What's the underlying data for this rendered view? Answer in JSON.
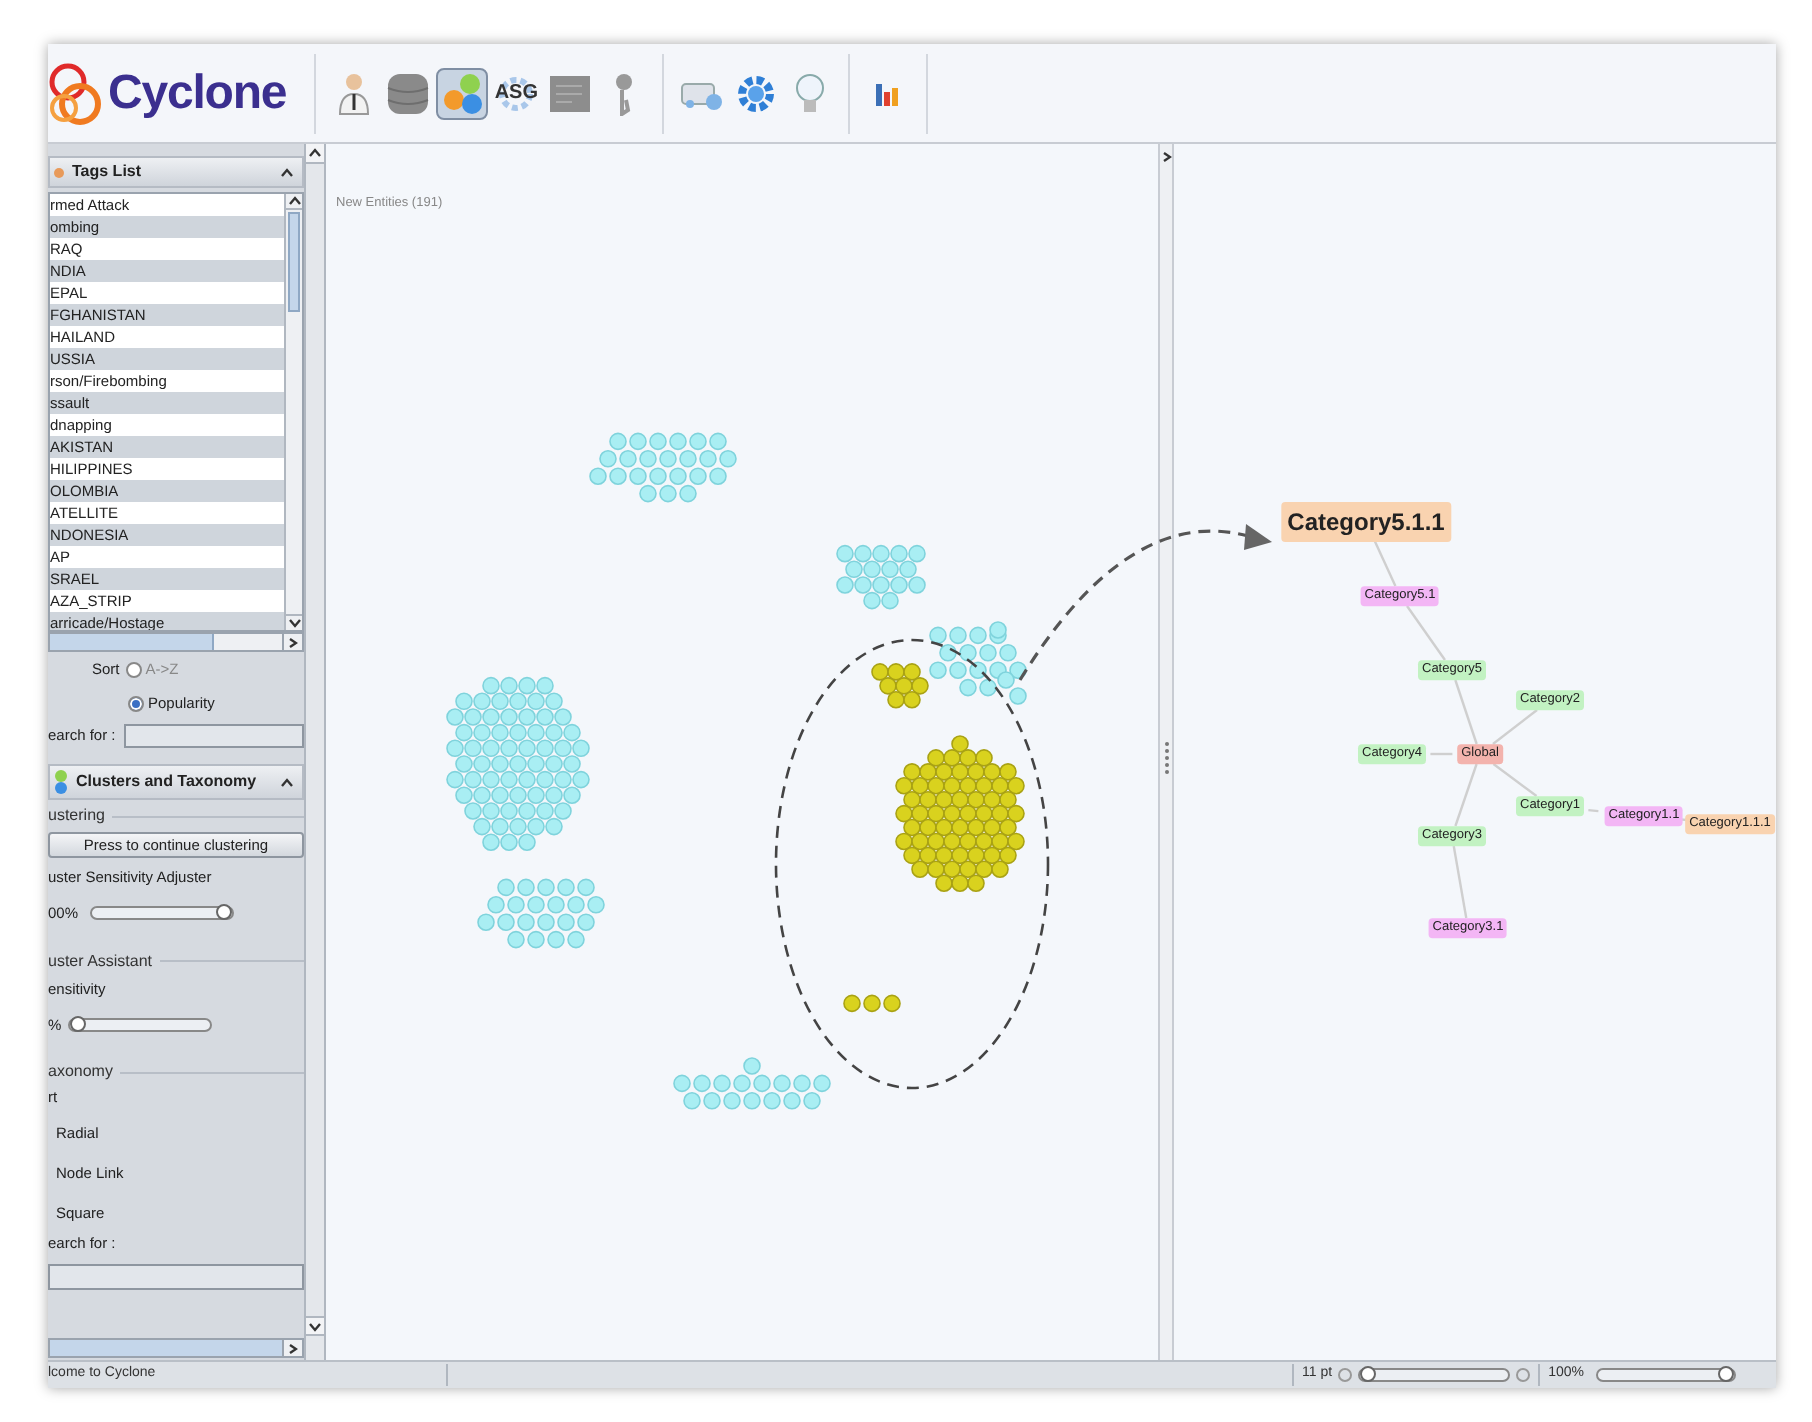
{
  "app": {
    "name": "Cyclone"
  },
  "toolbar": {
    "groups": [
      [
        {
          "kind": "person",
          "selected": false
        },
        {
          "kind": "database",
          "selected": false
        },
        {
          "kind": "clusters",
          "selected": true
        },
        {
          "kind": "gear-text",
          "label": "ASG",
          "selected": false
        },
        {
          "kind": "document",
          "selected": false
        },
        {
          "kind": "key",
          "selected": false
        }
      ],
      [
        {
          "kind": "network",
          "selected": false
        },
        {
          "kind": "gear",
          "selected": false
        },
        {
          "kind": "bulb",
          "selected": false
        }
      ],
      [
        {
          "kind": "chart",
          "selected": false
        }
      ]
    ]
  },
  "tags_panel": {
    "title": "Tags List",
    "tags": [
      "rmed Attack",
      "ombing",
      "RAQ",
      "NDIA",
      "EPAL",
      "FGHANISTAN",
      "HAILAND",
      "USSIA",
      "rson/Firebombing",
      "ssault",
      "dnapping",
      "AKISTAN",
      "HILIPPINES",
      "OLOMBIA",
      "ATELLITE",
      "NDONESIA",
      "AP",
      "SRAEL",
      "AZA_STRIP",
      "arricade/Hostage"
    ],
    "sort_label": "Sort",
    "sort_options": [
      {
        "label": "A->Z",
        "selected": false
      },
      {
        "label": "Popularity",
        "selected": true
      }
    ],
    "search_label": "earch for :"
  },
  "clusters_panel": {
    "title": "Clusters and Taxonomy",
    "clustering_heading": "ustering",
    "clustering_button": "Press to continue clustering",
    "sensitivity_adjuster": {
      "label": "uster Sensitivity Adjuster",
      "reading": "00%",
      "level": 1
    },
    "assistant_heading": "uster Assistant",
    "assistant_sensitivity": {
      "label": "ensitivity",
      "reading": "%",
      "level": 0
    },
    "taxonomy_heading": "axonomy",
    "sort_label": "rt",
    "taxonomy_options": [
      "Radial",
      "Node Link",
      "Square"
    ],
    "search_label": "earch for :"
  },
  "canvas": {
    "title": "New Entities (191)"
  },
  "taxonomy_graph": {
    "label": "Global",
    "selected": false,
    "children": [
      {
        "label": "Category5",
        "selected": false,
        "children": [
          {
            "label": "Category5.1",
            "selected": false,
            "children": [
              {
                "label": "Category5.1.1",
                "selected": true
              }
            ]
          }
        ]
      },
      {
        "label": "Category2",
        "selected": false
      },
      {
        "label": "Category4",
        "selected": false
      },
      {
        "label": "Category1",
        "selected": false,
        "children": [
          {
            "label": "Category1.1",
            "selected": false,
            "children": [
              {
                "label": "Category1.1.1",
                "selected": false
              }
            ]
          }
        ]
      },
      {
        "label": "Category3",
        "selected": false,
        "children": [
          {
            "label": "Category3.1",
            "selected": false
          }
        ]
      }
    ]
  },
  "status_bar": {
    "message": "lcome to Cyclone",
    "font_size": "11 pt",
    "font_slider": {
      "level": 0
    },
    "zoom": "100%",
    "zoom_slider": {
      "level": 1
    }
  }
}
